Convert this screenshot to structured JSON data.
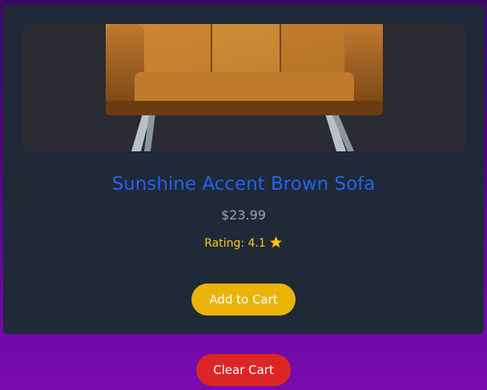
{
  "product": {
    "title": "Sunshine Accent Brown Sofa",
    "price": "$23.99",
    "rating_label": "Rating: 4.1",
    "rating_icon": "star-icon",
    "image_subject": "brown-leather-accent-chair",
    "add_to_cart_label": "Add to Cart"
  },
  "cart": {
    "clear_label": "Clear Cart"
  },
  "colors": {
    "title": "#2563eb",
    "add_button": "#eab308",
    "clear_button": "#dc2626",
    "rating": "#facc15",
    "card": "#1f2937"
  }
}
